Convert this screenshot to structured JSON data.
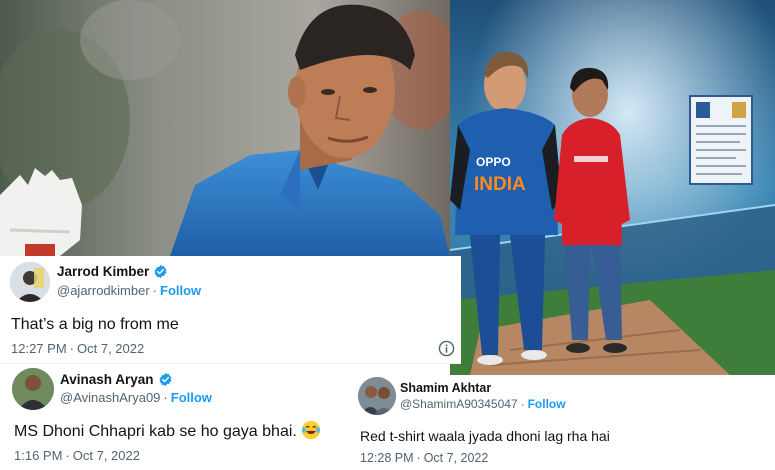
{
  "photos": {
    "left_icon": "player-portrait-photo",
    "right_icon": "wax-statue-photo",
    "jersey_text": "INDIA",
    "jersey_sponsor": "OPPO"
  },
  "tweets": [
    {
      "name": "Jarrod Kimber",
      "handle": "@ajarrodkimber",
      "follow_label": "Follow",
      "text": "That’s a big no from me",
      "time": "12:27 PM",
      "date": "Oct 7, 2022",
      "verified": true
    },
    {
      "name": "Avinash Aryan",
      "handle": "@AvinashArya09",
      "follow_label": "Follow",
      "text": "MS Dhoni Chhapri kab se ho gaya bhai.",
      "emoji": "laughing-tears-emoji",
      "time": "1:16 PM",
      "date": "Oct 7, 2022",
      "verified": true
    },
    {
      "name": "Shamim Akhtar",
      "handle": "@ShamimA90345047",
      "follow_label": "Follow",
      "text": "Red t-shirt waala jyada dhoni lag rha hai",
      "time": "12:28 PM",
      "date": "Oct 7, 2022",
      "verified": false
    }
  ],
  "colors": {
    "follow": "#1d9bf0",
    "secondary_text": "#536471",
    "jersey_blue": "#1f5fb0",
    "red_shirt": "#d8202a"
  }
}
